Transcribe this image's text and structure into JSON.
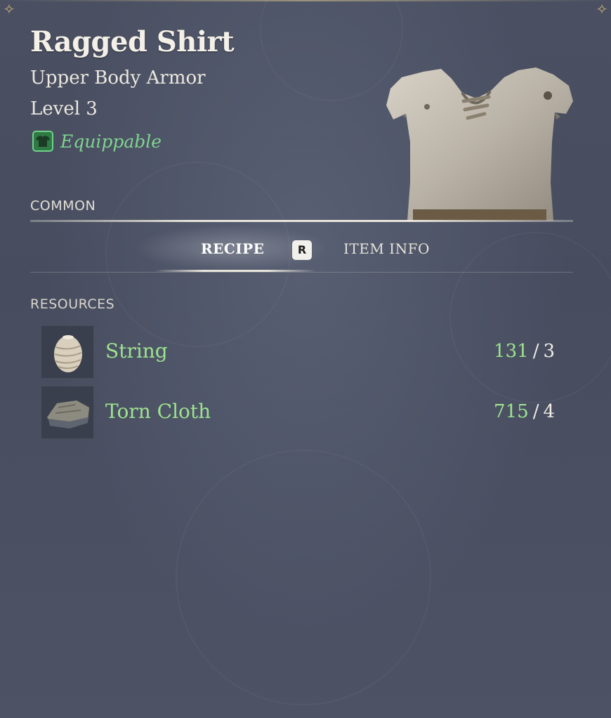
{
  "item": {
    "name": "Ragged Shirt",
    "type": "Upper Body Armor",
    "level": "Level 3",
    "equippable": "Equippable",
    "rarity": "COMMON"
  },
  "tabs": {
    "recipe": "RECIPE",
    "key": "R",
    "item_info": "ITEM INFO"
  },
  "resources": {
    "label": "RESOURCES",
    "items": [
      {
        "name": "String",
        "have": "131",
        "need": "3",
        "icon": "string-spool-icon"
      },
      {
        "name": "Torn Cloth",
        "have": "715",
        "need": "4",
        "icon": "torn-cloth-icon"
      }
    ]
  },
  "colors": {
    "accent_green": "#9de38f",
    "equippable_green": "#7fd48f",
    "panel_bg": "#474d5f"
  }
}
